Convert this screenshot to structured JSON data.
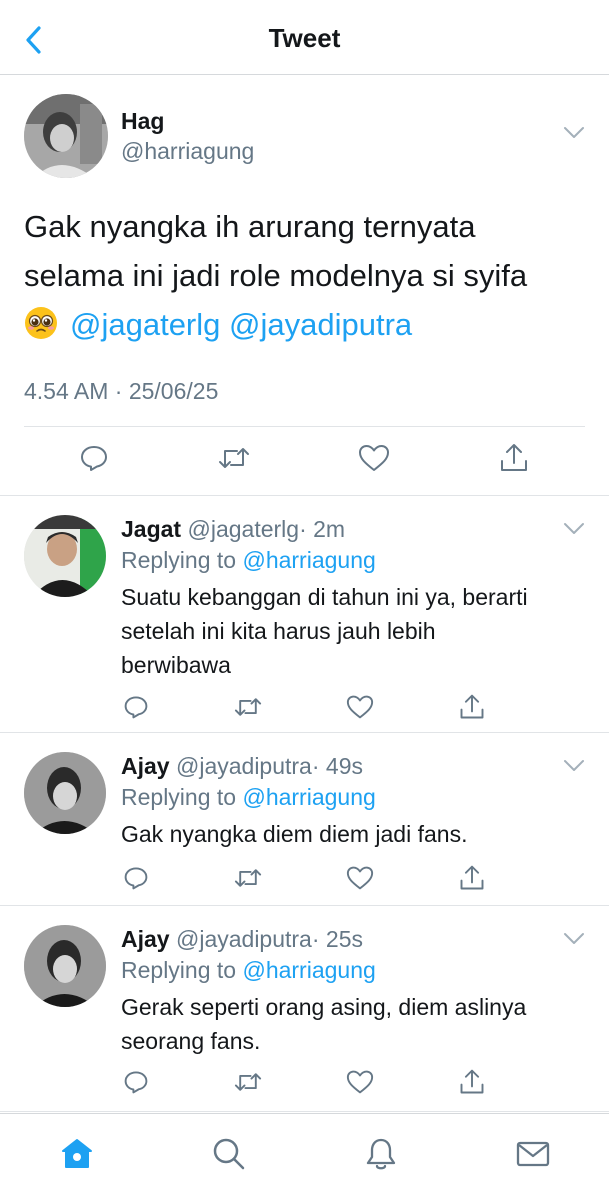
{
  "header": {
    "title": "Tweet"
  },
  "main_tweet": {
    "name": "Hag",
    "handle": "@harriagung",
    "text_line1": "Gak nyangka ih arurang ternyata",
    "text_line2": "selama ini jadi role modelnya si syifa",
    "emoji": "pleading-face-emoji",
    "mention1": "@jagaterlg",
    "mention2": "@jayadiputra",
    "timestamp": "4.54 AM · 25/06/25"
  },
  "replies": [
    {
      "name": "Jagat",
      "handle": "@jagaterlg",
      "time": "· 2m",
      "replying_prefix": "Replying to",
      "replying_to": "@harriagung",
      "line1": "Suatu kebanggan di tahun ini ya, berarti",
      "line2": "setelah ini kita harus jauh lebih",
      "line3": "berwibawa"
    },
    {
      "name": "Ajay",
      "handle": "@jayadiputra",
      "time": "· 49s",
      "replying_prefix": "Replying to",
      "replying_to": "@harriagung",
      "line1": "Gak nyangka diem diem jadi fans."
    },
    {
      "name": "Ajay",
      "handle": "@jayadiputra",
      "time": "· 25s",
      "replying_prefix": "Replying to",
      "replying_to": "@harriagung",
      "line1": "Gerak seperti orang asing, diem aslinya",
      "line2": "seorang fans."
    }
  ],
  "icons": {
    "back": "chevron-left-icon",
    "reply": "reply-icon",
    "retweet": "retweet-icon",
    "like": "heart-icon",
    "share": "share-icon",
    "home": "home-icon",
    "search": "search-icon",
    "notifications": "bell-icon",
    "messages": "mail-icon"
  },
  "colors": {
    "accent": "#1da1f2",
    "muted": "#657786",
    "text": "#14171a",
    "icon": "#657786",
    "divider": "#e1e4e7"
  }
}
